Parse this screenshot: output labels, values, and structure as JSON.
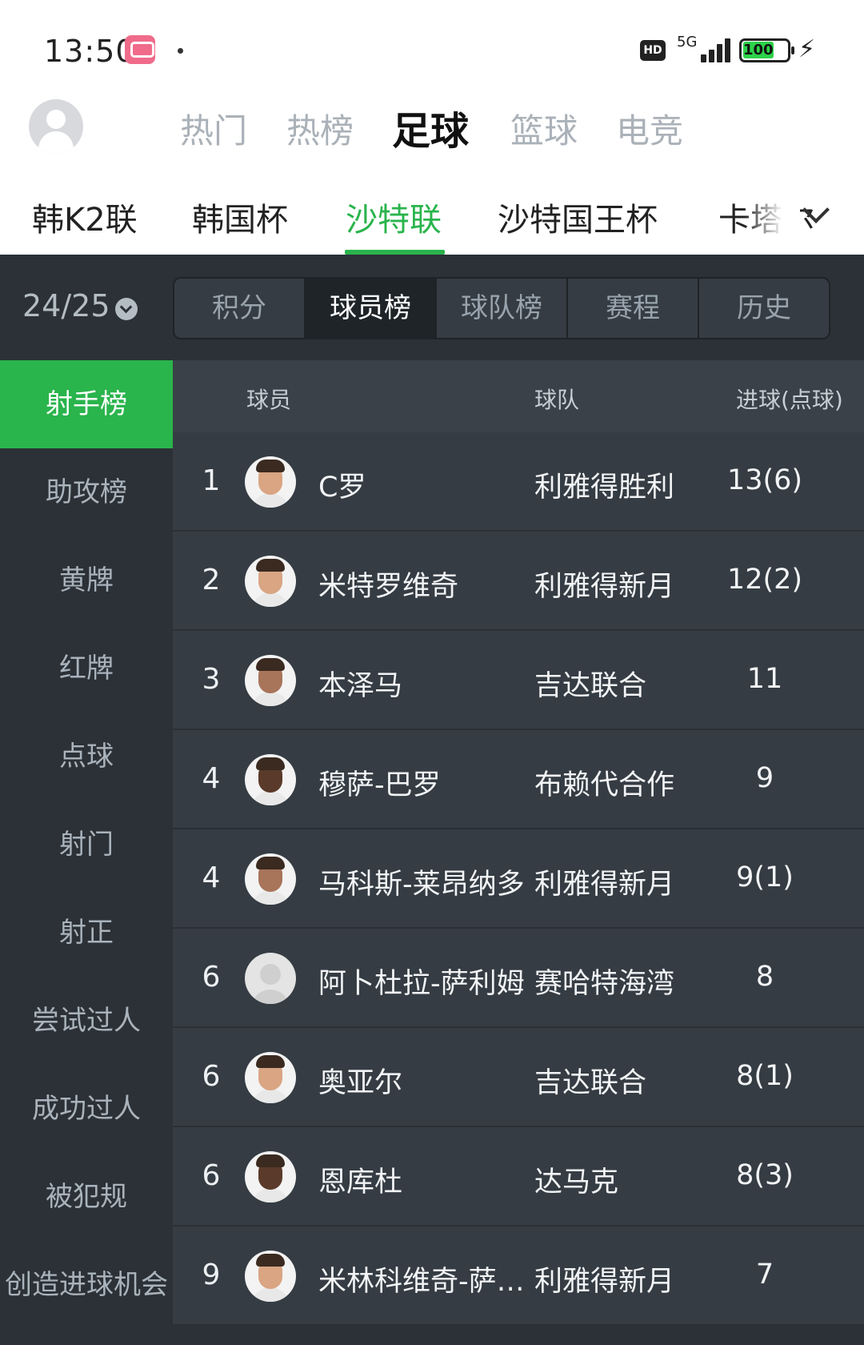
{
  "status_bar": {
    "time": "13:50",
    "network": "5G",
    "hd": "HD",
    "battery": "100"
  },
  "top_tabs": [
    "热门",
    "热榜",
    "足球",
    "篮球",
    "电竞"
  ],
  "top_tab_active": "足球",
  "leagues": [
    "韩K2联",
    "韩国杯",
    "沙特联",
    "沙特国王杯",
    "卡塔尔"
  ],
  "league_active": "沙特联",
  "season": "24/25",
  "sub_tabs": [
    "积分",
    "球员榜",
    "球队榜",
    "赛程",
    "历史"
  ],
  "sub_tab_active": "球员榜",
  "side_menu": [
    "射手榜",
    "助攻榜",
    "黄牌",
    "红牌",
    "点球",
    "射门",
    "射正",
    "尝试过人",
    "成功过人",
    "被犯规",
    "创造进球机会"
  ],
  "side_menu_active": "射手榜",
  "table": {
    "headers": {
      "player": "球员",
      "team": "球队",
      "goals": "进球(点球)"
    },
    "rows": [
      {
        "rank": "1",
        "player": "C罗",
        "team": "利雅得胜利",
        "goals": "13(6)"
      },
      {
        "rank": "2",
        "player": "米特罗维奇",
        "team": "利雅得新月",
        "goals": "12(2)"
      },
      {
        "rank": "3",
        "player": "本泽马",
        "team": "吉达联合",
        "goals": "11"
      },
      {
        "rank": "4",
        "player": "穆萨-巴罗",
        "team": "布赖代合作",
        "goals": "9"
      },
      {
        "rank": "4",
        "player": "马科斯-莱昂纳多",
        "team": "利雅得新月",
        "goals": "9(1)"
      },
      {
        "rank": "6",
        "player": "阿卜杜拉-萨利姆",
        "team": "赛哈特海湾",
        "goals": "8"
      },
      {
        "rank": "6",
        "player": "奥亚尔",
        "team": "吉达联合",
        "goals": "8(1)"
      },
      {
        "rank": "6",
        "player": "恩库杜",
        "team": "达马克",
        "goals": "8(3)"
      },
      {
        "rank": "9",
        "player": "米林科维奇-萨…",
        "team": "利雅得新月",
        "goals": "7"
      }
    ]
  },
  "colors": {
    "accent": "#2ab44c",
    "background": "#2b3137",
    "row": "#353c43"
  }
}
